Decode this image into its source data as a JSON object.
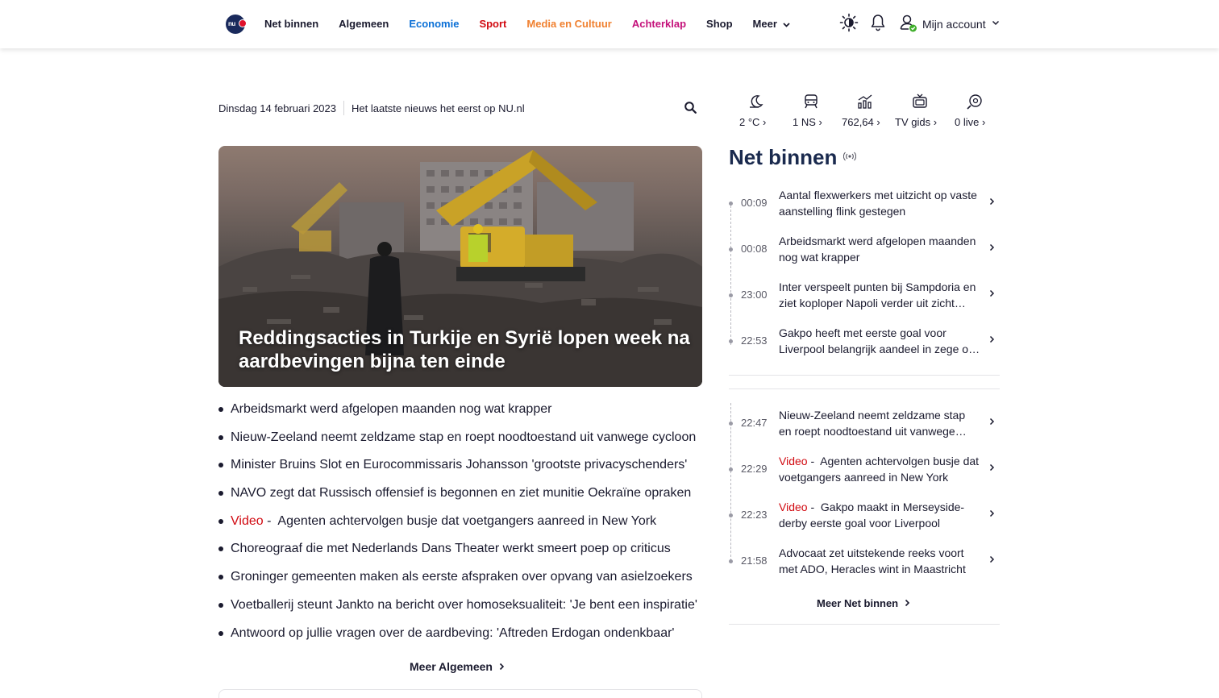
{
  "header": {
    "logo_text": "nu",
    "nav": [
      {
        "label": "Net binnen",
        "color": "#1a1a2e"
      },
      {
        "label": "Algemeen",
        "color": "#1a1a2e"
      },
      {
        "label": "Economie",
        "color": "#0a6fd6"
      },
      {
        "label": "Sport",
        "color": "#d10a11"
      },
      {
        "label": "Media en Cultuur",
        "color": "#f0802f"
      },
      {
        "label": "Achterklap",
        "color": "#c4117a"
      },
      {
        "label": "Shop",
        "color": "#1a1a2e"
      },
      {
        "label": "Meer",
        "color": "#1a1a2e"
      }
    ],
    "account_label": "Mijn account",
    "icons": [
      "theme-toggle-icon",
      "bell-icon",
      "user-icon"
    ]
  },
  "datebar": {
    "date": "Dinsdag 14 februari 2023",
    "tagline": "Het laatste nieuws het eerst op NU.nl"
  },
  "hero": {
    "title": "Reddingsacties in Turkije en Syrië lopen week na aardbevingen bijna ten einde"
  },
  "headlines": [
    {
      "video": "",
      "text": "Arbeidsmarkt werd afgelopen maanden nog wat krapper"
    },
    {
      "video": "",
      "text": "Nieuw-Zeeland neemt zeldzame stap en roept noodtoestand uit vanwege cycloon"
    },
    {
      "video": "",
      "text": "Minister Bruins Slot en Eurocommissaris Johansson 'grootste privacyschenders'"
    },
    {
      "video": "",
      "text": "NAVO zegt dat Russisch offensief is begonnen en ziet munitie Oekraïne opraken"
    },
    {
      "video": "Video",
      "text": "Agenten achtervolgen busje dat voetgangers aanreed in New York"
    },
    {
      "video": "",
      "text": "Choreograaf die met Nederlands Dans Theater werkt smeert poep op criticus"
    },
    {
      "video": "",
      "text": "Groninger gemeenten maken als eerste afspraken over opvang van asielzoekers"
    },
    {
      "video": "",
      "text": "Voetballerij steunt Jankto na bericht over homoseksualiteit: 'Je bent een inspiratie'"
    },
    {
      "video": "",
      "text": "Antwoord op jullie vragen over de aardbeving: 'Aftreden Erdogan ondenkbaar'"
    }
  ],
  "meer_algemeen": "Meer Algemeen",
  "stats": [
    {
      "icon": "weather-icon",
      "value": "2 °C"
    },
    {
      "icon": "train-icon",
      "value": "1 NS"
    },
    {
      "icon": "stock-icon",
      "value": "762,64"
    },
    {
      "icon": "tv-icon",
      "value": "TV gids"
    },
    {
      "icon": "live-score-icon",
      "value": "0 live"
    }
  ],
  "net_binnen": {
    "title": "Net binnen",
    "group1": [
      {
        "time": "00:09",
        "video": "",
        "text": "Aantal flexwerkers met uitzicht op vaste aanstelling flink gestegen"
      },
      {
        "time": "00:08",
        "video": "",
        "text": "Arbeidsmarkt werd afgelopen maanden nog wat krapper"
      },
      {
        "time": "23:00",
        "video": "",
        "text": "Inter verspeelt punten bij Sampdoria en ziet koploper Napoli verder uit zicht verdwijnen"
      },
      {
        "time": "22:53",
        "video": "",
        "text": "Gakpo heeft met eerste goal voor Liverpool belangrijk aandeel in zege op Everton"
      }
    ],
    "group2": [
      {
        "time": "22:47",
        "video": "",
        "text": "Nieuw-Zeeland neemt zeldzame stap en roept noodtoestand uit vanwege cycloon"
      },
      {
        "time": "22:29",
        "video": "Video",
        "text": "Agenten achtervolgen busje dat voetgangers aanreed in New York"
      },
      {
        "time": "22:23",
        "video": "Video",
        "text": "Gakpo maakt in Merseyside-derby eerste goal voor Liverpool"
      },
      {
        "time": "21:58",
        "video": "",
        "text": "Advocaat zet uitstekende reeks voort met ADO, Heracles wint in Maastricht"
      }
    ],
    "meer_label": "Meer Net binnen"
  }
}
